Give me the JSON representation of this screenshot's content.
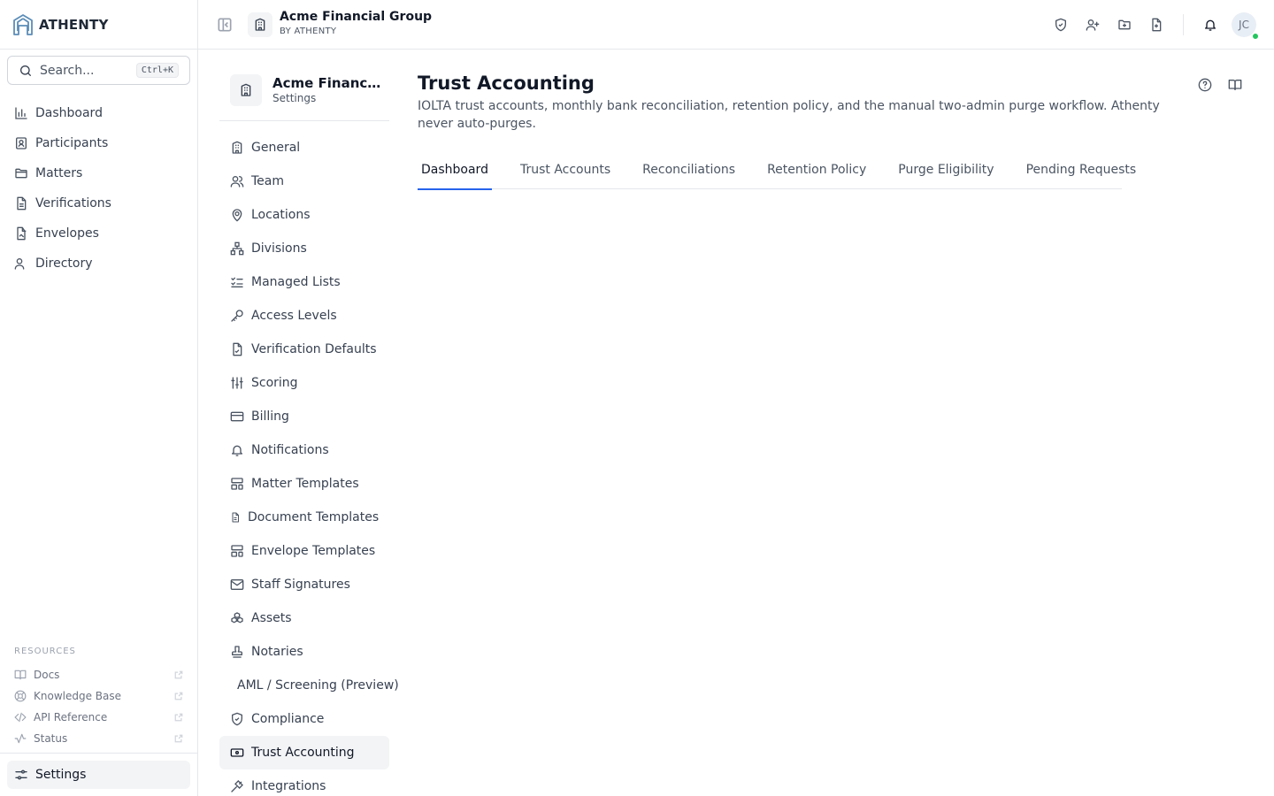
{
  "brand": {
    "name": "ATHENTY",
    "accent": "#5b8db8"
  },
  "search": {
    "placeholder": "Search...",
    "shortcut": "Ctrl+K"
  },
  "nav": [
    {
      "label": "Dashboard",
      "icon": "bar-chart-icon"
    },
    {
      "label": "Participants",
      "icon": "contact-card-icon"
    },
    {
      "label": "Matters",
      "icon": "folder-icon"
    },
    {
      "label": "Verifications",
      "icon": "file-text-icon"
    },
    {
      "label": "Envelopes",
      "icon": "file-signature-icon"
    },
    {
      "label": "Directory",
      "icon": "users-icon"
    }
  ],
  "resources": {
    "title": "RESOURCES",
    "items": [
      {
        "label": "Docs",
        "icon": "book-open-icon"
      },
      {
        "label": "Knowledge Base",
        "icon": "lifebuoy-icon"
      },
      {
        "label": "API Reference",
        "icon": "code-icon"
      },
      {
        "label": "Status",
        "icon": "activity-icon"
      }
    ]
  },
  "settings_link": {
    "label": "Settings",
    "icon": "sliders-icon"
  },
  "topbar": {
    "org_name": "Acme Financial Group",
    "org_sub": "BY ATHENTY",
    "avatar_initials": "JC",
    "actions": [
      "shield-check-icon",
      "user-plus-icon",
      "folder-plus-icon",
      "file-plus-icon",
      "bell-icon"
    ]
  },
  "settings_nav": {
    "title": "Acme Financial Group",
    "subtitle": "Settings",
    "items": [
      {
        "label": "General",
        "icon": "building-icon"
      },
      {
        "label": "Team",
        "icon": "users-icon"
      },
      {
        "label": "Locations",
        "icon": "map-pin-icon"
      },
      {
        "label": "Divisions",
        "icon": "network-icon"
      },
      {
        "label": "Managed Lists",
        "icon": "list-checks-icon"
      },
      {
        "label": "Access Levels",
        "icon": "key-icon"
      },
      {
        "label": "Verification Defaults",
        "icon": "file-check-icon"
      },
      {
        "label": "Scoring",
        "icon": "sliders-vertical-icon"
      },
      {
        "label": "Billing",
        "icon": "credit-card-icon"
      },
      {
        "label": "Notifications",
        "icon": "bell-icon"
      },
      {
        "label": "Matter Templates",
        "icon": "layout-template-icon"
      },
      {
        "label": "Document Templates",
        "icon": "file-icon"
      },
      {
        "label": "Envelope Templates",
        "icon": "layout-template-icon"
      },
      {
        "label": "Staff Signatures",
        "icon": "mail-icon"
      },
      {
        "label": "Assets",
        "icon": "boxes-icon"
      },
      {
        "label": "Notaries",
        "icon": "stamp-icon"
      },
      {
        "label": "AML / Screening (Preview)",
        "icon": ""
      },
      {
        "label": "Compliance",
        "icon": "shield-check-icon"
      },
      {
        "label": "Trust Accounting",
        "icon": "banknote-icon",
        "active": true
      },
      {
        "label": "Integrations",
        "icon": "plug-icon"
      }
    ]
  },
  "page": {
    "title": "Trust Accounting",
    "description": "IOLTA trust accounts, monthly bank reconciliation, retention policy, and the manual two-admin purge workflow. Athenty never auto-purges.",
    "help_icons": [
      "help-circle-icon",
      "book-open-icon"
    ],
    "tabs": [
      "Dashboard",
      "Trust Accounts",
      "Reconciliations",
      "Retention Policy",
      "Purge Eligibility",
      "Pending Requests"
    ],
    "active_tab": "Dashboard"
  }
}
